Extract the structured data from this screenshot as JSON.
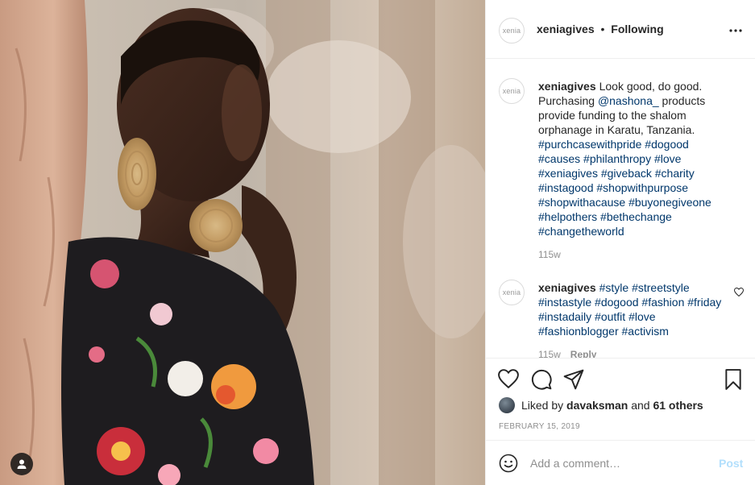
{
  "post": {
    "username": "xeniagives",
    "separator": "•",
    "follow_status": "Following",
    "avatar_text": "xenia",
    "photo_alt": "Woman with large gold earrings wearing a floral dress"
  },
  "comments": [
    {
      "username": "xeniagives",
      "avatar_text": "xenia",
      "text_before": "Look good, do good. Purchasing ",
      "mention": "@nashona_",
      "text_after": " products provide funding to the shalom orphanage in Karatu, Tanzania.",
      "hashtags": "#purchcasewithpride #dogood #causes #philanthropy #love #xeniagives #giveback #charity #instagood #shopwithpurpose #shopwithacause #buyonegiveone #helpothers #bethechange #changetheworld",
      "time": "115w"
    },
    {
      "username": "xeniagives",
      "avatar_text": "xenia",
      "hashtags": "#style #streetstyle #instastyle #dogood #fashion #friday #instadaily #outfit #love #fashionblogger #activism",
      "time": "115w",
      "reply": "Reply"
    }
  ],
  "likes": {
    "prefix": "Liked by ",
    "user": "davaksman",
    "middle": " and ",
    "others": "61 others"
  },
  "date": "FEBRUARY 15, 2019",
  "comment_box": {
    "placeholder": "Add a comment…",
    "post_label": "Post"
  },
  "icons": {
    "like": "heart-icon",
    "comment": "comment-bubble-icon",
    "share": "paper-plane-icon",
    "save": "bookmark-icon",
    "more": "more-dots-icon",
    "emoji": "emoji-icon",
    "user_tag": "user-tag-icon"
  },
  "colors": {
    "link": "#00376b",
    "muted": "#8e8e8e",
    "post_disabled": "#b2dffc"
  }
}
